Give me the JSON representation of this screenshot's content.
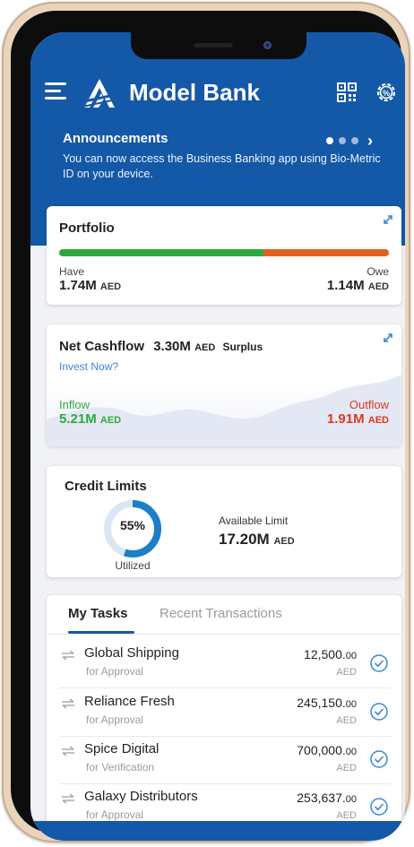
{
  "app": {
    "title": "Model Bank"
  },
  "announcements": {
    "title": "Announcements",
    "text": "You can now access the Business Banking app using Bio-Metric ID on your device."
  },
  "portfolio": {
    "title": "Portfolio",
    "have_fraction": 0.62,
    "have_label": "Have",
    "have_amount": "1.74M",
    "owe_label": "Owe",
    "owe_amount": "1.14M",
    "currency": "AED"
  },
  "cashflow": {
    "title": "Net Cashflow",
    "amount": "3.30M",
    "currency": "AED",
    "status": "Surplus",
    "invest_link": "Invest Now?",
    "inflow_label": "Inflow",
    "inflow_amount": "5.21M",
    "outflow_label": "Outflow",
    "outflow_amount": "1.91M"
  },
  "credit": {
    "title": "Credit Limits",
    "utilized_pct": "55%",
    "utilized_fraction": 0.55,
    "utilized_label": "Utilized",
    "available_label": "Available Limit",
    "available_amount": "17.20M",
    "currency": "AED"
  },
  "tabs": [
    {
      "label": "My Tasks",
      "active": true
    },
    {
      "label": "Recent Transactions",
      "active": false
    }
  ],
  "tasks": [
    {
      "name": "Global Shipping",
      "sub": "for Approval",
      "amount": "12,500.",
      "decimal": "00",
      "currency": "AED"
    },
    {
      "name": "Reliance Fresh",
      "sub": "for Approval",
      "amount": "245,150.",
      "decimal": "00",
      "currency": "AED"
    },
    {
      "name": "Spice Digital",
      "sub": "for Verification",
      "amount": "700,000.",
      "decimal": "00",
      "currency": "AED"
    },
    {
      "name": "Galaxy Distributors",
      "sub": "for Approval",
      "amount": "253,637.",
      "decimal": "00",
      "currency": "AED"
    }
  ],
  "colors": {
    "brand": "#1458a8",
    "have": "#2eaa3c",
    "owe": "#e0621e",
    "outflow": "#d83a1e",
    "link": "#3a86d8"
  },
  "icons": {
    "menu": "menu-icon",
    "logo": "model-bank-logo",
    "qr": "qr-code-icon",
    "settings": "gear-icon",
    "expand": "expand-icon",
    "transfer": "transfer-arrows-icon",
    "approve": "check-circle-icon"
  }
}
